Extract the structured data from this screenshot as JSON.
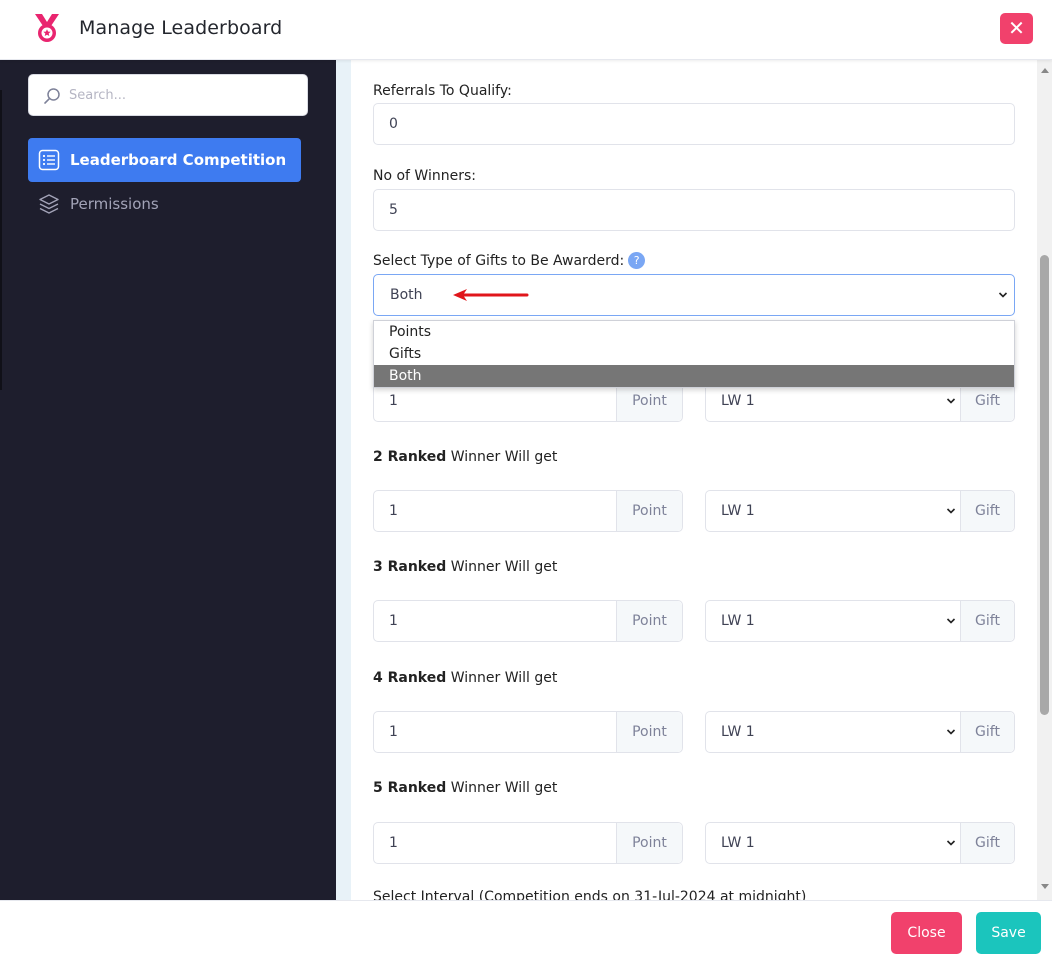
{
  "header": {
    "title": "Manage Leaderboard",
    "close_icon": "✕"
  },
  "sidebar": {
    "search_placeholder": "Search...",
    "items": [
      {
        "label": "Leaderboard Competition",
        "icon": "list-icon",
        "active": true
      },
      {
        "label": "Permissions",
        "icon": "layers-icon",
        "active": false
      }
    ]
  },
  "form": {
    "referrals_label": "Referrals To Qualify:",
    "referrals_value": "0",
    "winners_label": "No of Winners:",
    "winners_value": "5",
    "gift_type_label": "Select Type of Gifts to Be Awarderd:",
    "gift_type_help": "?",
    "gift_type_value": "Both",
    "gift_type_options": [
      "Points",
      "Gifts",
      "Both"
    ],
    "ranks": [
      {
        "rank": "",
        "label": "",
        "point_value": "1",
        "point_addon": "Point",
        "gift_value": "LW 1",
        "gift_addon": "Gift"
      },
      {
        "rank": "2 Ranked",
        "label": " Winner Will get",
        "point_value": "1",
        "point_addon": "Point",
        "gift_value": "LW 1",
        "gift_addon": "Gift"
      },
      {
        "rank": "3 Ranked",
        "label": " Winner Will get",
        "point_value": "1",
        "point_addon": "Point",
        "gift_value": "LW 1",
        "gift_addon": "Gift"
      },
      {
        "rank": "4 Ranked",
        "label": " Winner Will get",
        "point_value": "1",
        "point_addon": "Point",
        "gift_value": "LW 1",
        "gift_addon": "Gift"
      },
      {
        "rank": "5 Ranked",
        "label": " Winner Will get",
        "point_value": "1",
        "point_addon": "Point",
        "gift_value": "LW 1",
        "gift_addon": "Gift"
      }
    ],
    "interval_label": "Select Interval (Competition ends on 31-Jul-2024 at midnight)"
  },
  "footer": {
    "close_label": "Close",
    "save_label": "Save"
  },
  "colors": {
    "sidebar_bg": "#1e1e2d",
    "accent": "#3e7bf0",
    "danger": "#f1416c",
    "success": "#1bc5bd",
    "annotation_arrow": "#e0161b"
  }
}
